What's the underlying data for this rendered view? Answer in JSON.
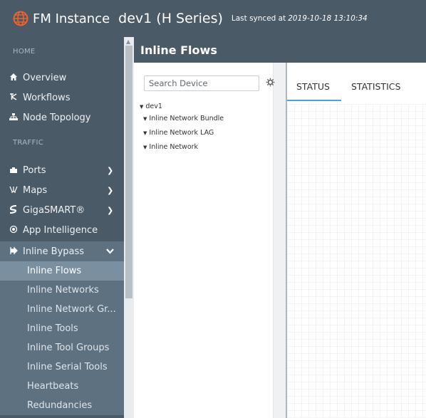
{
  "header": {
    "app_name": "FM Instance",
    "device_name": "dev1 (H Series)",
    "sync_label": "Last synced at",
    "sync_time": "2019-10-18 13:10:34"
  },
  "sidebar": {
    "home_heading": "HOME",
    "traffic_heading": "TRAFFIC",
    "home_items": [
      {
        "label": "Overview",
        "icon": "home-icon"
      },
      {
        "label": "Workflows",
        "icon": "workflow-icon"
      },
      {
        "label": "Node Topology",
        "icon": "topology-icon"
      }
    ],
    "traffic_items": [
      {
        "label": "Ports",
        "icon": "ports-icon",
        "expandable": true
      },
      {
        "label": "Maps",
        "icon": "maps-icon",
        "expandable": true
      },
      {
        "label": "GigaSMART®",
        "icon": "gigasmart-icon",
        "expandable": true
      },
      {
        "label": "App Intelligence",
        "icon": "app-intelligence-icon",
        "expandable": false
      },
      {
        "label": "Inline Bypass",
        "icon": "inline-bypass-icon",
        "expandable": true,
        "expanded": true
      }
    ],
    "inline_bypass_children": [
      {
        "label": "Inline Flows",
        "active": true
      },
      {
        "label": "Inline Networks"
      },
      {
        "label": "Inline Network Gr..."
      },
      {
        "label": "Inline Tools"
      },
      {
        "label": "Inline Tool Groups"
      },
      {
        "label": "Inline Serial Tools"
      },
      {
        "label": "Heartbeats"
      },
      {
        "label": "Redundancies"
      }
    ]
  },
  "page": {
    "title": "Inline Flows"
  },
  "tree": {
    "search_placeholder": "Search Device",
    "root": "dev1",
    "children": [
      "Inline Network Bundle",
      "Inline Network LAG",
      "Inline Network"
    ]
  },
  "tabs": [
    {
      "label": "STATUS",
      "active": true
    },
    {
      "label": "STATISTICS",
      "active": false
    }
  ],
  "colors": {
    "nav_bg": "#4a5a67",
    "submenu_bg": "#5d7181",
    "active_item_bg": "#7a8f9f",
    "globe": "#f0622a",
    "tab_accent": "#4aa3df"
  }
}
